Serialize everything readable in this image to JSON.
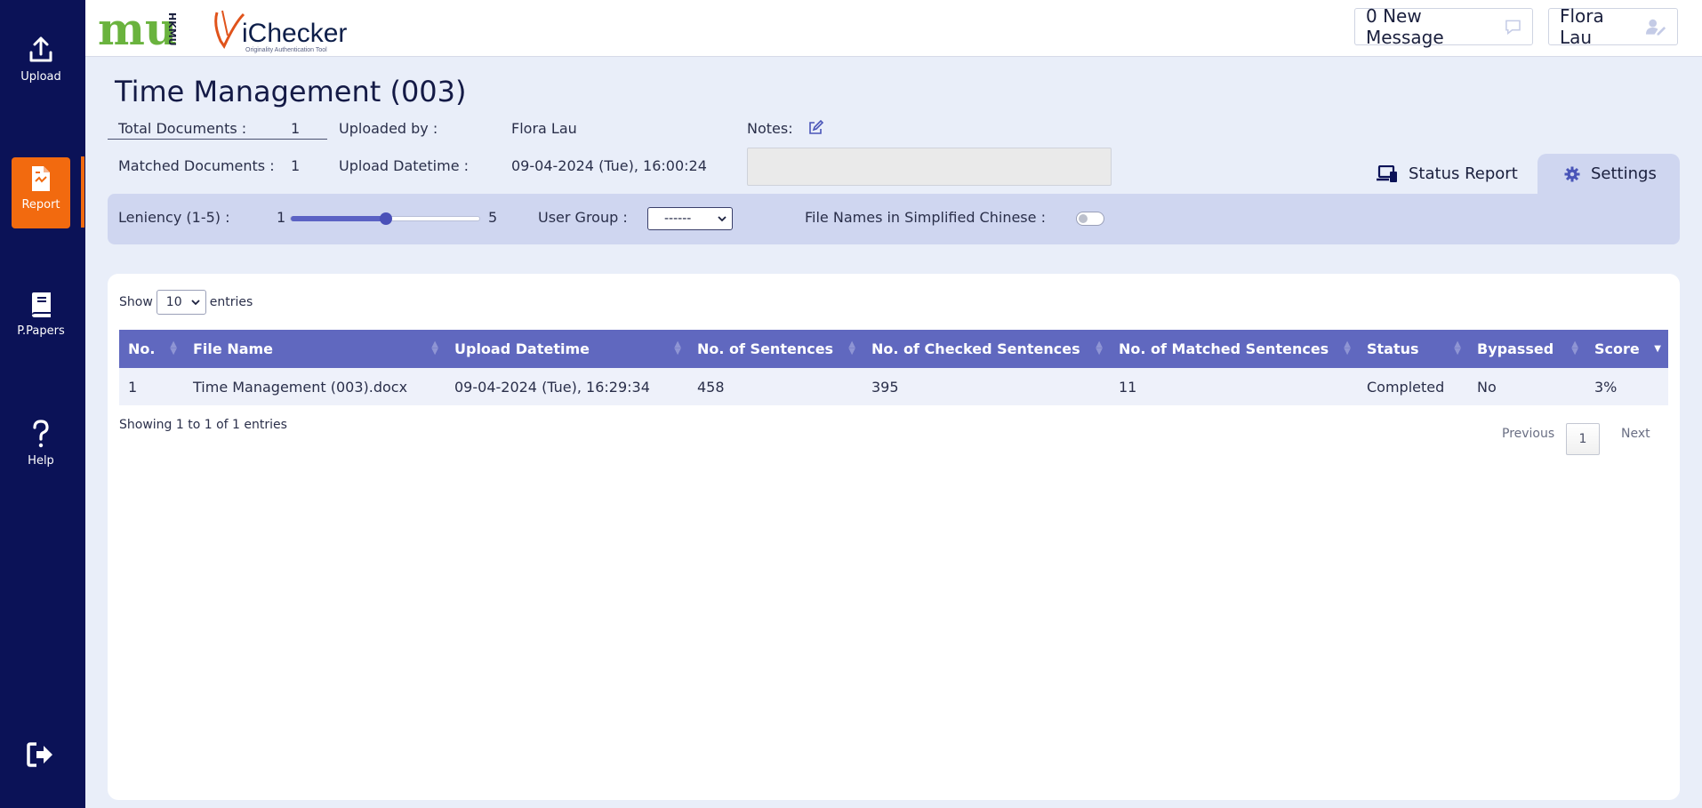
{
  "sidebar": {
    "items": [
      {
        "label": "Upload",
        "icon": "upload-icon"
      },
      {
        "label": "Report",
        "icon": "report-icon",
        "active": true
      },
      {
        "label": "P.Papers",
        "icon": "book-icon"
      },
      {
        "label": "Help",
        "icon": "question-icon"
      }
    ],
    "logout_icon": "logout-icon"
  },
  "header": {
    "messages_label": "0 New Message",
    "user_name": "Flora Lau",
    "logo_mu_text": "mu",
    "logo_hkmu_text": "HKMU",
    "logo_ichecker_text": "iChecker",
    "logo_ichecker_tagline": "Originality Authentication Tool"
  },
  "page": {
    "title": "Time Management (003)",
    "total_documents_label": "Total Documents :",
    "total_documents_value": "1",
    "matched_documents_label": "Matched Documents :",
    "matched_documents_value": "1",
    "uploaded_by_label": "Uploaded by :",
    "uploaded_by_value": "Flora Lau",
    "upload_datetime_label": "Upload Datetime :",
    "upload_datetime_value": "09-04-2024 (Tue), 16:00:24",
    "notes_label": "Notes:"
  },
  "tabs": {
    "status_report": "Status Report",
    "settings": "Settings"
  },
  "settings": {
    "leniency_label": "Leniency (1-5) :",
    "leniency_min": "1",
    "leniency_max": "5",
    "leniency_value": 3,
    "user_group_label": "User Group :",
    "user_group_value": "------",
    "simplified_chinese_label": "File Names in Simplified Chinese :",
    "simplified_chinese_on": false
  },
  "table": {
    "show_label": "Show",
    "entries_label": "entries",
    "page_length": "10",
    "columns": [
      "No.",
      "File Name",
      "Upload Datetime",
      "No. of Sentences",
      "No. of Checked Sentences",
      "No. of Matched Sentences",
      "Status",
      "Bypassed",
      "Score"
    ],
    "rows": [
      [
        "1",
        "Time Management (003).docx",
        "09-04-2024 (Tue), 16:29:34",
        "458",
        "395",
        "11",
        "Completed",
        "No",
        "3%"
      ]
    ],
    "info": "Showing 1 to 1 of 1 entries",
    "previous": "Previous",
    "next": "Next",
    "current_page": "1"
  },
  "colors": {
    "sidebar_bg": "#0b1257",
    "accent": "#f26a0f",
    "table_header": "#6068bf",
    "settings_bg": "#cfd6f0"
  }
}
